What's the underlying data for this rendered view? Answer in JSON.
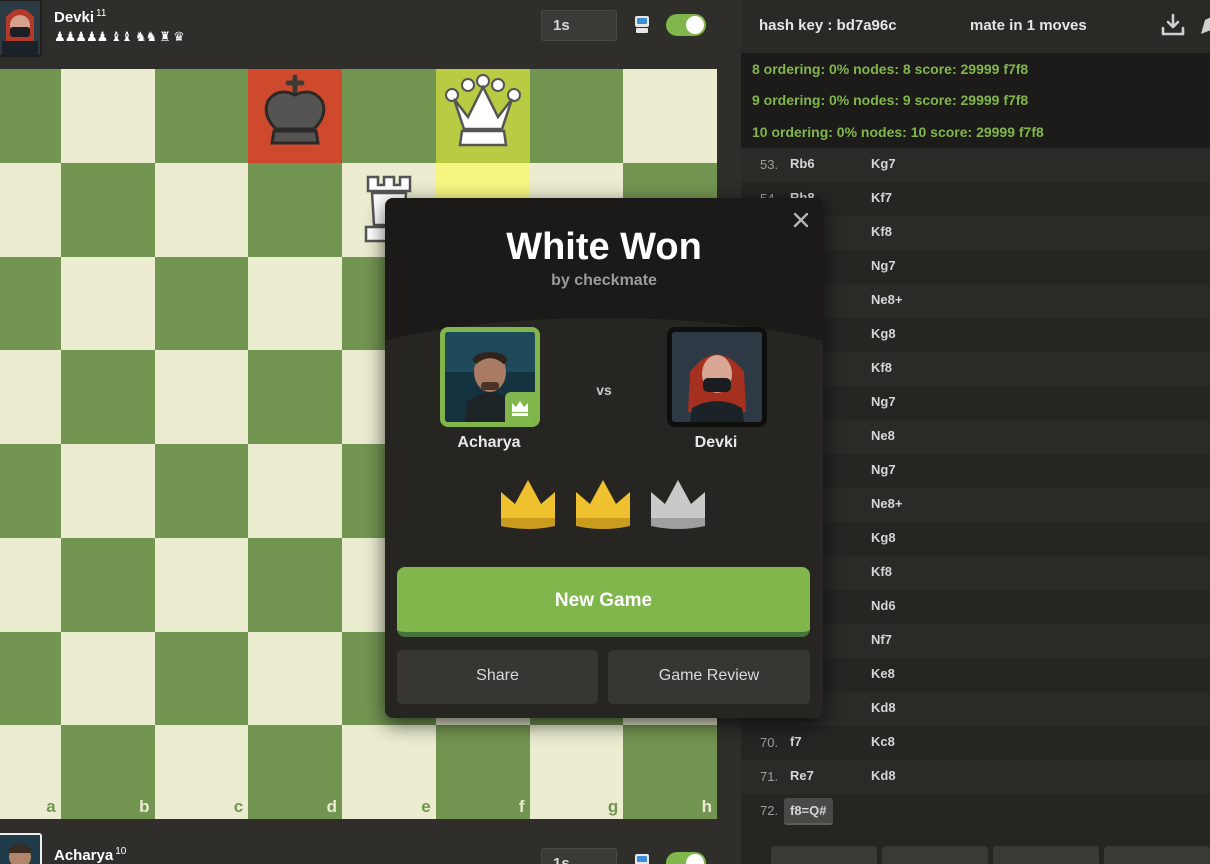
{
  "top_player": {
    "name": "Devki",
    "rating": "11",
    "captured": "♟♟♟♟♟ ♝♝ ♞♞ ♜ ♛",
    "clock": "1s"
  },
  "bottom_player": {
    "name": "Acharya",
    "rating": "10",
    "clock": "1s"
  },
  "board": {
    "files": [
      "a",
      "b",
      "c",
      "d",
      "e",
      "f",
      "g",
      "h"
    ],
    "colors": {
      "light": "#ebecd0",
      "dark": "#739552",
      "king_check": "#cf4a2c",
      "last_move_to": "#b9ca43",
      "last_move_from": "#f5f682"
    }
  },
  "engine": {
    "hash_key": "hash key : bd7a96c",
    "mate_text": "mate in 1 moves",
    "lines": [
      "8 ordering: 0% nodes: 8 score: 29999 f7f8",
      "9 ordering: 0% nodes: 9 score: 29999 f7f8",
      "10 ordering: 0% nodes: 10 score: 29999 f7f8"
    ]
  },
  "moves": [
    {
      "num": "53.",
      "white": "Rb6",
      "black": "Kg7"
    },
    {
      "num": "54.",
      "white": "Rb8",
      "black": "Kf7"
    },
    {
      "num": "",
      "white": "",
      "black": "Kf8"
    },
    {
      "num": "",
      "white": "",
      "black": "Ng7"
    },
    {
      "num": "",
      "white": "",
      "black": "Ne8+"
    },
    {
      "num": "",
      "white": "",
      "black": "Kg8"
    },
    {
      "num": "",
      "white": "",
      "black": "Kf8"
    },
    {
      "num": "",
      "white": "",
      "black": "Ng7"
    },
    {
      "num": "",
      "white": "",
      "black": "Ne8"
    },
    {
      "num": "",
      "white": "",
      "black": "Ng7"
    },
    {
      "num": "",
      "white": "",
      "black": "Ne8+"
    },
    {
      "num": "",
      "white": "",
      "black": "Kg8"
    },
    {
      "num": "",
      "white": "",
      "black": "Kf8"
    },
    {
      "num": "",
      "white": "",
      "black": "Nd6"
    },
    {
      "num": "",
      "white": "",
      "black": "Nf7"
    },
    {
      "num": "",
      "white": "",
      "black": "Ke8"
    },
    {
      "num": "",
      "white": "",
      "black": "Kd8"
    },
    {
      "num": "70.",
      "white": "f7",
      "black": "Kc8"
    },
    {
      "num": "71.",
      "white": "Re7",
      "black": "Kd8"
    },
    {
      "num": "72.",
      "white": "f8=Q#",
      "black": ""
    }
  ],
  "modal": {
    "title": "White Won",
    "subtitle": "by checkmate",
    "white_name": "Acharya",
    "black_name": "Devki",
    "vs": "vs",
    "new_game": "New Game",
    "share": "Share",
    "review": "Game Review",
    "colors": {
      "accent": "#81b64c",
      "gold_crown": "#f0c12e",
      "silver_crown": "#c9c9c9"
    }
  }
}
